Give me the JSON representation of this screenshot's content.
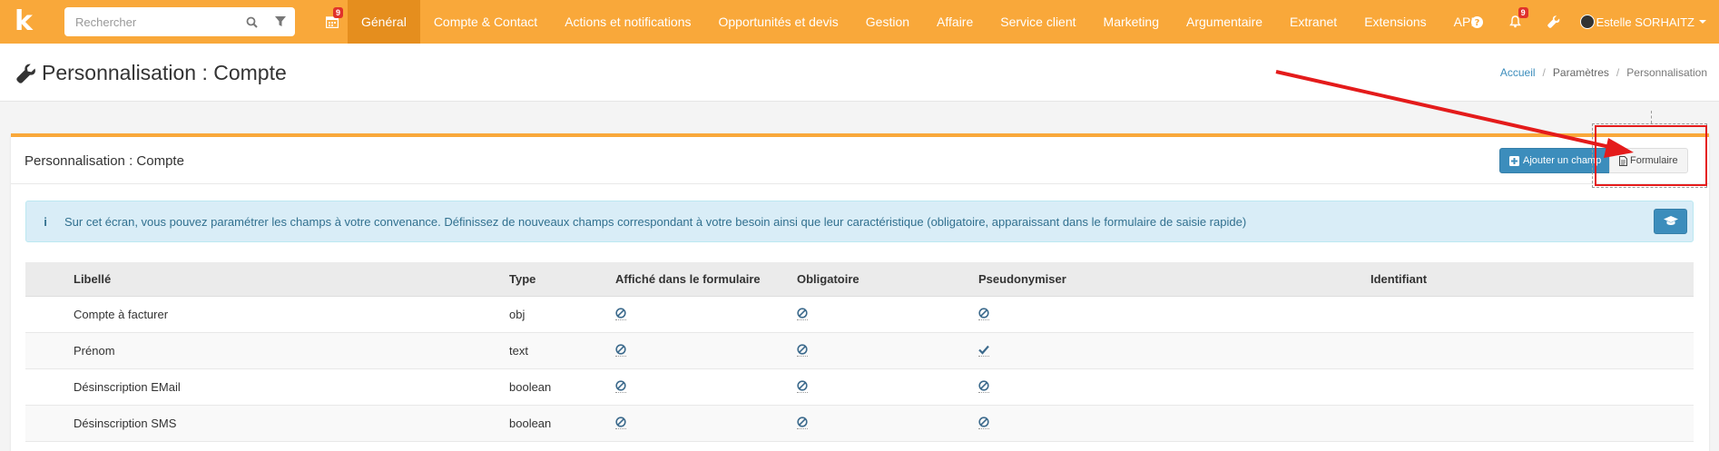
{
  "topbar": {
    "logo_text": "k",
    "search_placeholder": "Rechercher",
    "calendar_badge": "9",
    "menu": [
      {
        "label": "Général",
        "active": true
      },
      {
        "label": "Compte & Contact",
        "active": false
      },
      {
        "label": "Actions et notifications",
        "active": false
      },
      {
        "label": "Opportunités et devis",
        "active": false
      },
      {
        "label": "Gestion",
        "active": false
      },
      {
        "label": "Affaire",
        "active": false
      },
      {
        "label": "Service client",
        "active": false
      },
      {
        "label": "Marketing",
        "active": false
      },
      {
        "label": "Argumentaire",
        "active": false
      },
      {
        "label": "Extranet",
        "active": false
      },
      {
        "label": "Extensions",
        "active": false
      },
      {
        "label": "API",
        "active": false
      }
    ],
    "notif_badge": "9",
    "user_name": "Estelle SORHAITZ",
    "accent_color": "#f9a83a",
    "active_color": "#e58e1e"
  },
  "header": {
    "title": "Personnalisation : Compte",
    "breadcrumb": [
      "Accueil",
      "Paramètres",
      "Personnalisation"
    ]
  },
  "panel": {
    "title": "Personnalisation : Compte",
    "add_button": "Ajouter un champ",
    "form_button": "Formulaire",
    "info_text": "Sur cet écran, vous pouvez paramétrer les champs à votre convenance. Définissez de nouveaux champs correspondant à votre besoin ainsi que leur caractéristique (obligatoire, apparaissant dans le formulaire de saisie rapide)"
  },
  "table": {
    "headers": [
      "Libellé",
      "Type",
      "Affiché dans le formulaire",
      "Obligatoire",
      "Pseudonymiser",
      "Identifiant"
    ],
    "rows": [
      {
        "label": "Compte à facturer",
        "type": "obj",
        "form": "no",
        "required": "no",
        "pseudo": "no"
      },
      {
        "label": "Prénom",
        "type": "text",
        "form": "no",
        "required": "no",
        "pseudo": "yes"
      },
      {
        "label": "Désinscription EMail",
        "type": "boolean",
        "form": "no",
        "required": "no",
        "pseudo": "no"
      },
      {
        "label": "Désinscription SMS",
        "type": "boolean",
        "form": "no",
        "required": "no",
        "pseudo": "no"
      }
    ]
  }
}
